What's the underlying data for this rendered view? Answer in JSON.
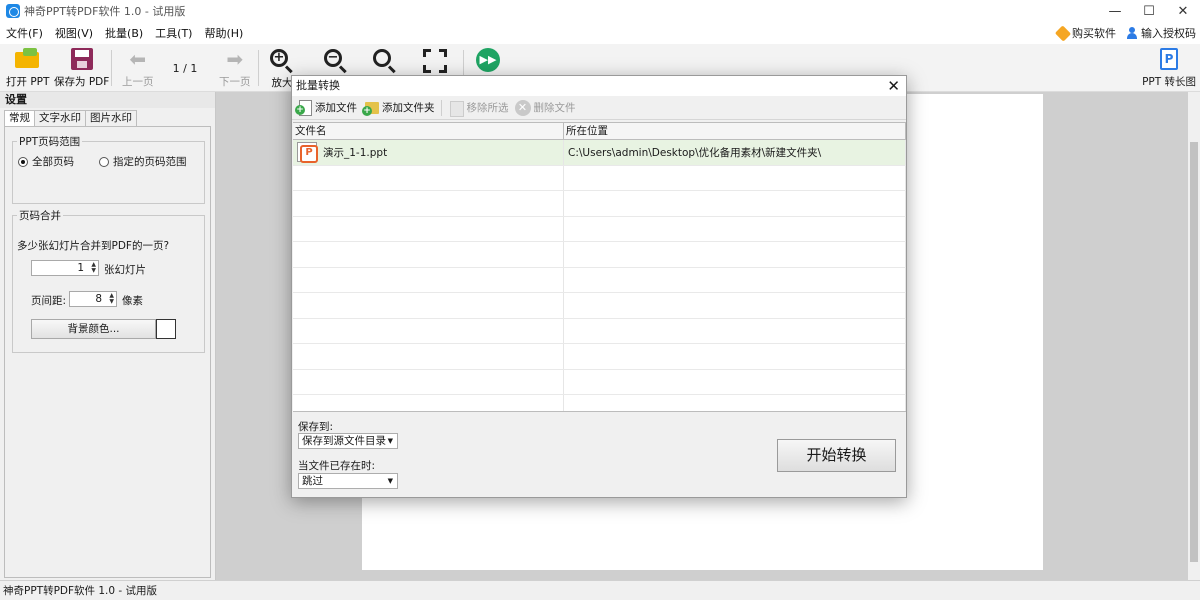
{
  "window": {
    "title": "神奇PPT转PDF软件 1.0 - 试用版",
    "minimize": "—",
    "maximize": "☐",
    "close": "✕"
  },
  "menu": {
    "items": [
      "文件(F)",
      "视图(V)",
      "批量(B)",
      "工具(T)",
      "帮助(H)"
    ],
    "buy": "购买软件",
    "license": "输入授权码"
  },
  "toolbar": {
    "open_ppt": "打开 PPT",
    "save_pdf": "保存为 PDF",
    "prev_page": "上一页",
    "page_indicator": "1 / 1",
    "next_page": "下一页",
    "zoom_in": "放大",
    "ppt_long": "PPT 转长图",
    "ppt_long_icon": "P"
  },
  "left_panel": {
    "title": "设置",
    "tabs": [
      "常规",
      "文字水印",
      "图片水印"
    ],
    "range_group": "PPT页码范围",
    "radio_all": "全部页码",
    "radio_custom": "指定的页码范围",
    "merge_group": "页码合并",
    "merge_question": "多少张幻灯片合并到PDF的一页?",
    "slides_value": "1",
    "slides_unit": "张幻灯片",
    "spacing_label": "页间距:",
    "spacing_value": "8",
    "spacing_unit": "像素",
    "bg_color_button": "背景颜色...",
    "bg_color": "#ffffff"
  },
  "dialog": {
    "title": "批量转换",
    "close": "✕",
    "add_file": "添加文件",
    "add_folder": "添加文件夹",
    "remove_selected": "移除所选",
    "delete_file": "删除文件",
    "columns": [
      "文件名",
      "所在位置"
    ],
    "rows": [
      {
        "name": "演示_1-1.ppt",
        "location": "C:\\Users\\admin\\Desktop\\优化备用素材\\新建文件夹\\"
      }
    ],
    "save_to_label": "保存到:",
    "save_to_value": "保存到源文件目录",
    "exists_label": "当文件已存在时:",
    "exists_value": "跳过",
    "start_button": "开始转换"
  },
  "status": {
    "text": "神奇PPT转PDF软件 1.0 - 试用版"
  },
  "colors": {
    "selected_row": "#e8f3e2",
    "accent_green": "#1fa463",
    "accent_blue": "#2c7be5"
  }
}
